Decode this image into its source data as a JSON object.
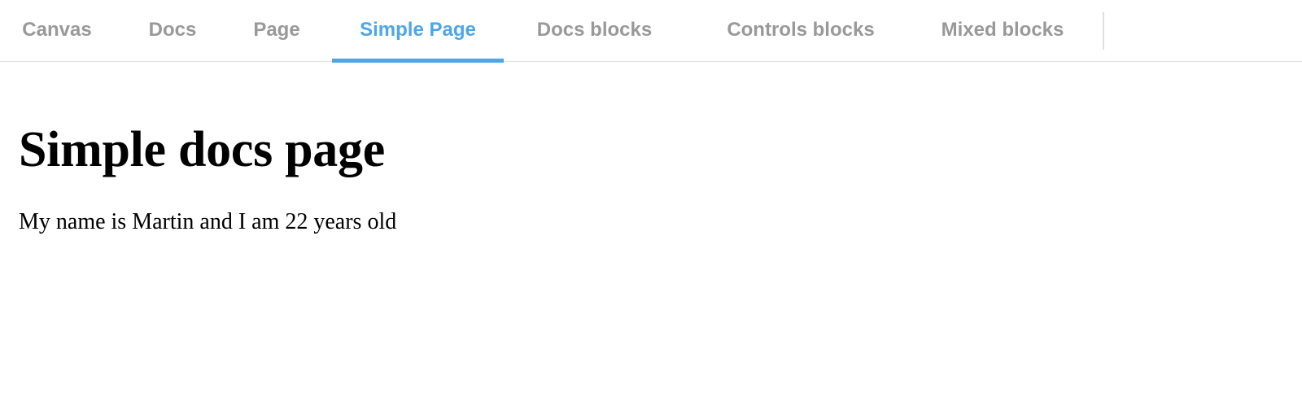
{
  "tabs": [
    {
      "label": "Canvas",
      "active": false
    },
    {
      "label": "Docs",
      "active": false
    },
    {
      "label": "Page",
      "active": false
    },
    {
      "label": "Simple Page",
      "active": true
    },
    {
      "label": "Docs blocks",
      "active": false
    },
    {
      "label": "Controls blocks",
      "active": false
    },
    {
      "label": "Mixed blocks",
      "active": false
    }
  ],
  "content": {
    "title": "Simple docs page",
    "text": "My name is Martin and I am 22 years old"
  },
  "colors": {
    "active_tab": "#4ea6e6",
    "inactive_tab": "#999999",
    "divider": "#e0e0e0"
  }
}
